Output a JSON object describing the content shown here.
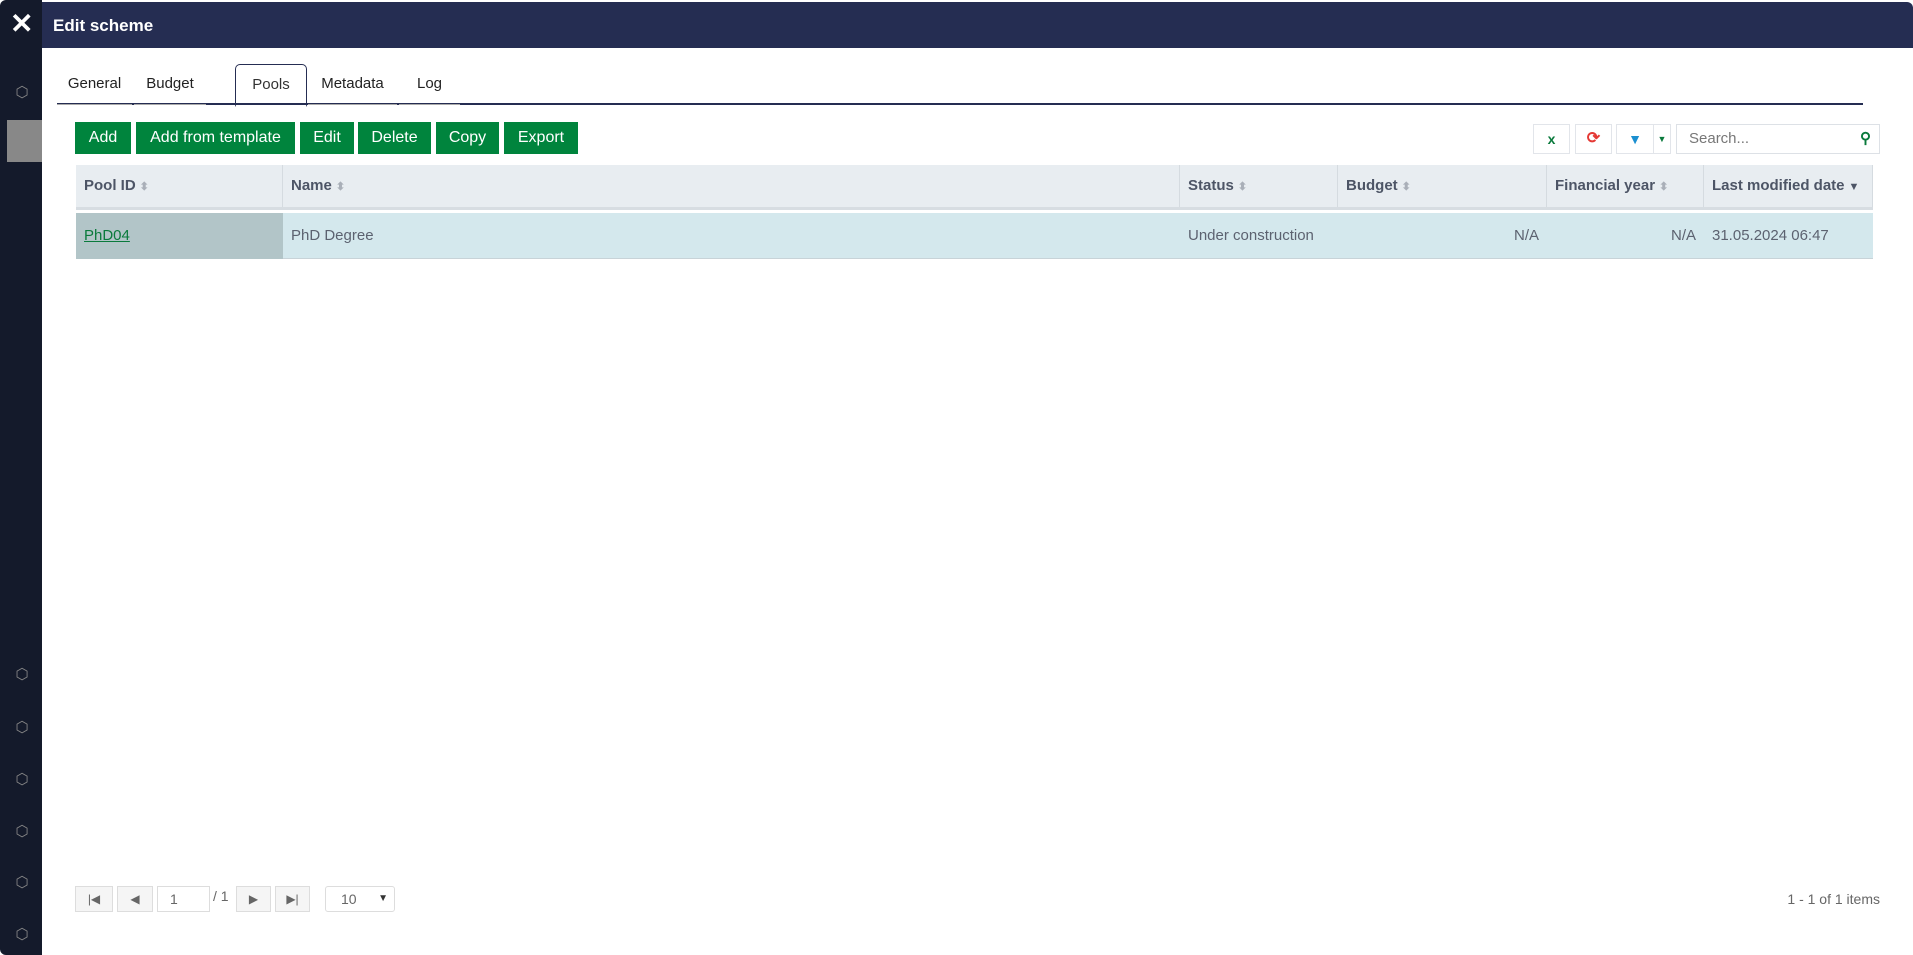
{
  "window": {
    "title": "Edit scheme",
    "close_icon": "close-x-icon"
  },
  "sidebar": {
    "icon": "codepen-cube-icon"
  },
  "tabs": [
    {
      "label": "General"
    },
    {
      "label": "Budget"
    },
    {
      "label": "Pools",
      "active": true
    },
    {
      "label": "Metadata"
    },
    {
      "label": "Log"
    }
  ],
  "toolbar": {
    "buttons": [
      "Add",
      "Add from template",
      "Edit",
      "Delete",
      "Copy",
      "Export"
    ],
    "excel_icon": "excel-export-icon",
    "refresh_icon": "refresh-icon",
    "filter_icon": "filter-icon",
    "search_placeholder": "Search...",
    "accent": "#00843d"
  },
  "table": {
    "columns": [
      "Pool ID",
      "Name",
      "Status",
      "Budget",
      "Financial year",
      "Last modified date"
    ],
    "rows": [
      {
        "pool_id": "PhD04",
        "name": "PhD Degree",
        "status": "Under construction",
        "budget": "N/A",
        "financial_year": "N/A",
        "last_modified": "31.05.2024 06:47"
      }
    ]
  },
  "pagination": {
    "page": "1",
    "total_pages": "/ 1",
    "page_size": "10",
    "summary": "1 - 1 of 1 items"
  }
}
